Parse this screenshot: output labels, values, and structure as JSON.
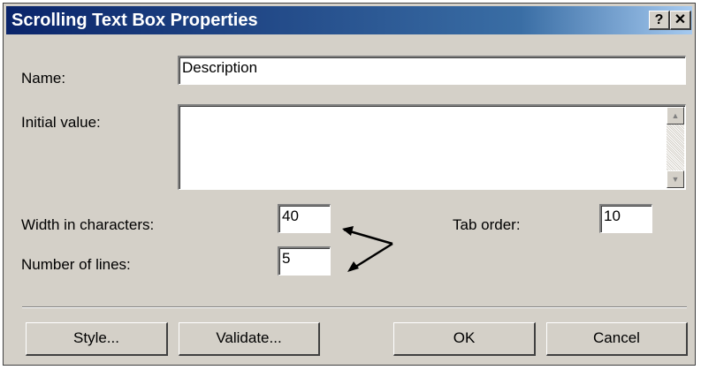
{
  "window": {
    "title": "Scrolling Text Box Properties",
    "help_label": "?",
    "close_label": "✕"
  },
  "form": {
    "name_label": "Name:",
    "name_value": "Description",
    "initial_value_label": "Initial value:",
    "initial_value": "",
    "width_label": "Width in characters:",
    "width_value": "40",
    "lines_label": "Number of lines:",
    "lines_value": "5",
    "tab_order_label": "Tab order:",
    "tab_order_value": "10"
  },
  "buttons": {
    "style": "Style...",
    "validate": "Validate...",
    "ok": "OK",
    "cancel": "Cancel"
  },
  "icons": {
    "scroll_up": "scroll-up-arrow-icon",
    "scroll_down": "scroll-down-arrow-icon",
    "annotation": "annotation-arrows-icon"
  }
}
